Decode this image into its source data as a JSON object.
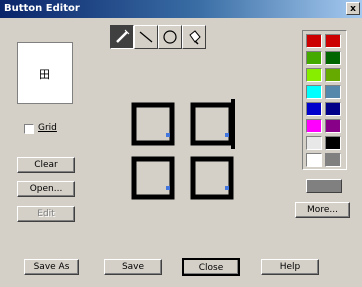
{
  "window": {
    "title": "Button Editor",
    "close_label": "x"
  },
  "preview": {
    "icon_glyph": "田"
  },
  "grid": {
    "label": "Grid",
    "checked": false
  },
  "buttons": {
    "clear": "Clear",
    "open": "Open...",
    "edit": "Edit",
    "more": "More...",
    "save_as": "Save As",
    "save": "Save",
    "close": "Close",
    "help": "Help"
  },
  "tools": [
    {
      "name": "pencil-icon",
      "active": true
    },
    {
      "name": "line-icon",
      "active": false
    },
    {
      "name": "ellipse-icon",
      "active": false
    },
    {
      "name": "fill-icon",
      "active": false
    }
  ],
  "palette": {
    "colors": [
      "#cc0000",
      "#cc0000",
      "#44aa00",
      "#006600",
      "#88ee00",
      "#66aa00",
      "#00ffff",
      "#5588aa",
      "#0000cc",
      "#000088",
      "#ff00ff",
      "#880088",
      "#e8e8e8",
      "#000000",
      "#ffffff",
      "#808080"
    ],
    "current": "#808080"
  }
}
